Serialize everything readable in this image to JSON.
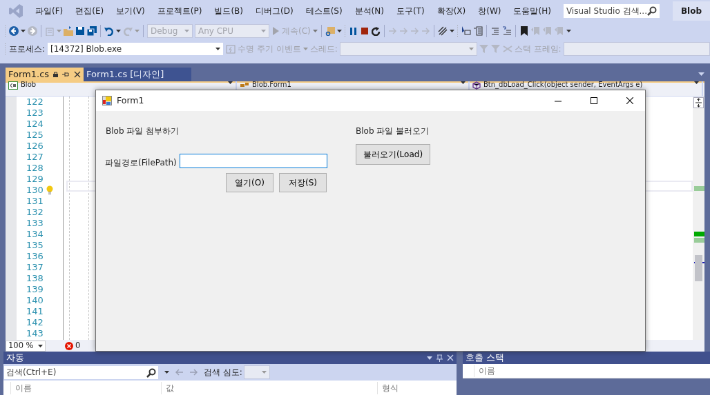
{
  "menu": {
    "items": [
      "파일(F)",
      "편집(E)",
      "보기(V)",
      "프로젝트(P)",
      "빌드(B)",
      "디버그(D)",
      "테스트(S)",
      "분석(N)",
      "도구(T)",
      "확장(X)",
      "창(W)",
      "도움말(H)"
    ],
    "search": {
      "placeholder": "Visual Studio 검색..."
    },
    "solution_name": "Blob"
  },
  "toolbar": {
    "combos": [
      {
        "value": "Debug",
        "disabled": true
      },
      {
        "value": "Any CPU",
        "disabled": true
      }
    ],
    "continue": {
      "label": "계속(C)",
      "disabled": true
    }
  },
  "debug_location": {
    "process_label": "프로세스:",
    "process": "[14372] Blob.exe",
    "lifecycle": "수명 주기 이벤트",
    "thread_label": "스레드:",
    "stack_frame_label": "스택 프레임:"
  },
  "tabs": [
    {
      "label": "Form1.cs",
      "selected": true
    },
    {
      "label": "Form1.cs [디자인]",
      "selected": false
    }
  ],
  "navigation": {
    "project": "Blob",
    "type": "Blob.Form1",
    "member": "Btn_dbLoad_Click(object sender, EventArgs e)"
  },
  "editor": {
    "line_numbers": [
      "122",
      "123",
      "124",
      "125",
      "126",
      "127",
      "128",
      "129",
      "130",
      "131",
      "132",
      "133",
      "134",
      "135",
      "136",
      "137",
      "138",
      "139",
      "140",
      "141",
      "142",
      "143"
    ],
    "zoom": "100 %",
    "errors": "0"
  },
  "form_window": {
    "title": "Form1",
    "attach_heading": "Blob 파일 첨부하기",
    "path_label": "파일경로(FilePath)",
    "open_button": "열기(O)",
    "save_button": "저장(S)",
    "load_heading": "Blob 파일 불러오기",
    "load_button": "불러오기(Load)"
  },
  "autos_panel": {
    "title": "자동",
    "search": {
      "placeholder": "검색(Ctrl+E)"
    },
    "depth_label": "검색 심도:",
    "columns": [
      "이름",
      "값",
      "형식"
    ]
  },
  "call_stack_panel": {
    "title": "호출 스택",
    "columns": [
      "이름"
    ]
  }
}
